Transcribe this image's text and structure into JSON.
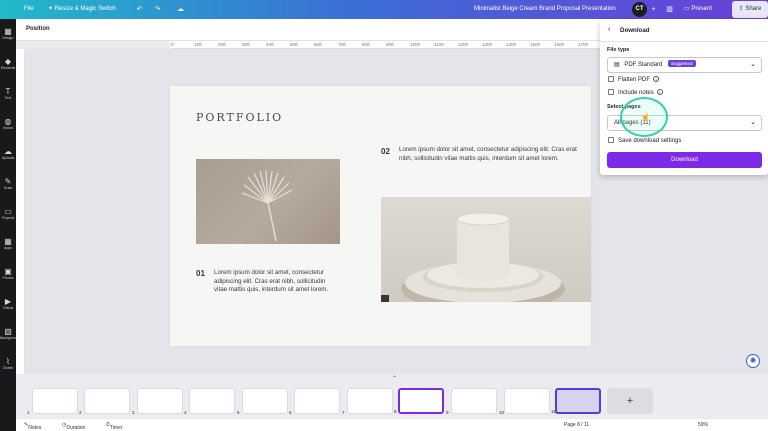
{
  "topbar": {
    "file": "File",
    "resize": "Resize & Magic Switch",
    "doc_title": "Minimalist Beige Cream Brand Proposal Presentation",
    "avatar": "CT",
    "present": "Present",
    "share": "Share"
  },
  "rail": {
    "items": [
      "Design",
      "Elements",
      "Text",
      "Brand",
      "Uploads",
      "Draw",
      "Projects",
      "Apps",
      "Photos",
      "Videos",
      "Background",
      "Charts"
    ]
  },
  "position_label": "Position",
  "ruler": [
    "0",
    "100",
    "200",
    "300",
    "400",
    "500",
    "600",
    "700",
    "800",
    "900",
    "1000",
    "1100",
    "1200",
    "1300",
    "1400",
    "1500",
    "1600",
    "1700",
    "1800",
    "1900"
  ],
  "slide": {
    "title": "PORTFOLIO",
    "num1": "01",
    "text1": "Lorem ipsum dolor sit amet, consectetur adipiscing elit. Cras erat nibh, sollicitudin vitae mattis quis, interdum sit amet lorem.",
    "num2": "02",
    "text2": "Lorem ipsum dolor sit amet, consectetur adipiscing elit. Cras erat nibh, sollicitudin vitae mattis quis, interdum sit amet lorem."
  },
  "download": {
    "title": "Download",
    "file_type_label": "File type",
    "file_type_value": "PDF Standard",
    "suggested": "Suggested",
    "flatten": "Flatten PDF",
    "include_notes": "Include notes",
    "select_pages_label": "Select pages",
    "pages_value": "All pages (11)",
    "save_settings": "Save download settings",
    "button": "Download"
  },
  "thumbnails": [
    "1",
    "2",
    "3",
    "4",
    "5",
    "6",
    "7",
    "8",
    "9",
    "10",
    "11"
  ],
  "bottom": {
    "notes": "Notes",
    "duration": "Duration",
    "timer": "Timer",
    "page": "Page 8 / 11",
    "zoom": "59%"
  },
  "colors": {
    "accent": "#7d2ae8",
    "highlight": "#32d1a8"
  }
}
